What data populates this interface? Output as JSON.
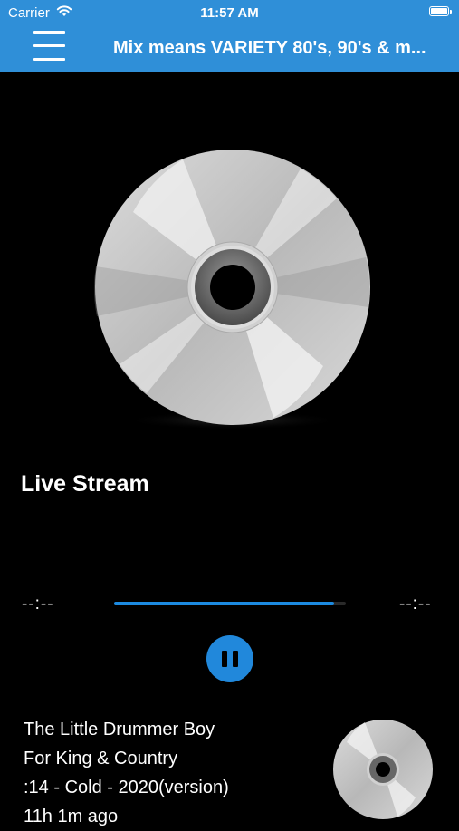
{
  "status_bar": {
    "carrier": "Carrier",
    "time": "11:57 AM"
  },
  "header": {
    "title": "Mix means VARIETY 80's, 90's & m...",
    "menu_icon": "hamburger-menu-icon",
    "background": "#2f8fd8"
  },
  "player": {
    "stream_label": "Live Stream",
    "elapsed": "--:--",
    "remaining": "--:--",
    "progress_percent": 95,
    "accent": "#2188db",
    "play_state_icon": "pause-icon"
  },
  "now_playing": {
    "song": "The Little Drummer Boy",
    "artist": "For King & Country",
    "details": ":14 - Cold - 2020(version)",
    "ago": "11h 1m ago"
  }
}
